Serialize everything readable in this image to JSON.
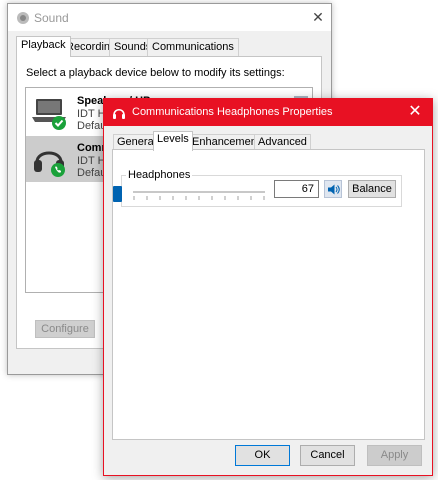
{
  "sound_window": {
    "title": "Sound",
    "tabs": [
      "Playback",
      "Recording",
      "Sounds",
      "Communications"
    ],
    "instruction": "Select a playback device below to modify its settings:",
    "devices": [
      {
        "name": "Speakers / HP",
        "line2": "IDT Hi",
        "line3": "Defau"
      },
      {
        "name": "Comm",
        "line2": "IDT Hi",
        "line3": "Defau"
      }
    ],
    "configure_label": "Configure"
  },
  "props_window": {
    "title": "Communications Headphones Properties",
    "tabs": [
      "General",
      "Levels",
      "Enhancements",
      "Advanced"
    ],
    "headphones_label": "Headphones",
    "level_value": "67",
    "level_fraction": 0.67,
    "balance_label": "Balance",
    "ok_label": "OK",
    "cancel_label": "Cancel",
    "apply_label": "Apply"
  },
  "colors": {
    "accent": "#0063b1",
    "title_active": "#e81123",
    "check_green": "#1aa13a"
  }
}
